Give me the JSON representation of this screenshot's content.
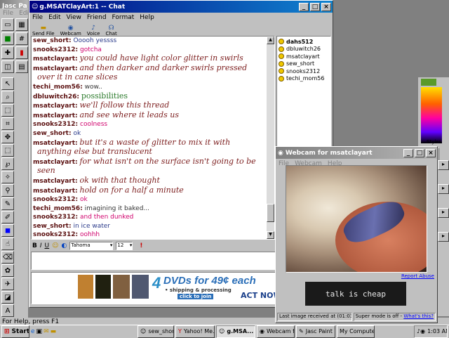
{
  "paint": {
    "title": "Jasc Pa",
    "menu": [
      "File",
      "Edit"
    ],
    "status": "For Help, press F1"
  },
  "chat": {
    "title": "g.MSATClayArt:1 -- Chat",
    "menu": [
      "File",
      "Edit",
      "View",
      "Friend",
      "Format",
      "Help"
    ],
    "toolbar": [
      "Send File",
      "Webcam",
      "Voice",
      "Chat"
    ],
    "messages": [
      {
        "nick": "sew_short:",
        "text": "Ooooh yessss",
        "style": "navy"
      },
      {
        "nick": "snooks2312:",
        "text": "gotcha",
        "style": "pink"
      },
      {
        "nick": "msatclayart:",
        "text": "you could have light color glitter in swirls",
        "style": "script"
      },
      {
        "nick": "msatclayart:",
        "text": "and then darker and darker swirls pressed",
        "style": "script"
      },
      {
        "nick": "",
        "text": "over it in cane slices",
        "style": "script"
      },
      {
        "nick": "techi_mom56:",
        "text": "wow..",
        "style": "gray"
      },
      {
        "nick": "dbluwitch26:",
        "text": "possibilities",
        "style": "green"
      },
      {
        "nick": "msatclayart:",
        "text": "we'll follow this thread",
        "style": "script"
      },
      {
        "nick": "msatclayart:",
        "text": "and see where it leads us",
        "style": "script"
      },
      {
        "nick": "snooks2312:",
        "text": "coolness",
        "style": "pink"
      },
      {
        "nick": "sew_short:",
        "text": "ok",
        "style": "navy"
      },
      {
        "nick": "msatclayart:",
        "text": "but it's a waste of glitter to mix it with",
        "style": "script"
      },
      {
        "nick": "",
        "text": "anything else but translucent",
        "style": "script"
      },
      {
        "nick": "msatclayart:",
        "text": "for what isn't on the surface isn't going to be",
        "style": "script"
      },
      {
        "nick": "",
        "text": "seen",
        "style": "script"
      },
      {
        "nick": "msatclayart:",
        "text": "ok with that thought",
        "style": "script"
      },
      {
        "nick": "msatclayart:",
        "text": "hold on for a half a minute",
        "style": "script"
      },
      {
        "nick": "snooks2312:",
        "text": "ok",
        "style": "pink"
      },
      {
        "nick": "techi_mom56:",
        "text": "imagining it baked...",
        "style": "gray"
      },
      {
        "nick": "snooks2312:",
        "text": "and then dunked",
        "style": "pink"
      },
      {
        "nick": "sew_short:",
        "text": "in ice water",
        "style": "navy"
      },
      {
        "nick": "snooks2312:",
        "text": "oohhh",
        "style": "pink"
      }
    ],
    "users": [
      "dahs512",
      "dbluwitch26",
      "msatclayart",
      "sew_short",
      "snooks2312",
      "techi_mom56"
    ],
    "font": "Tahoma",
    "size": "12",
    "ad": {
      "big": "DVDs for 49¢ each",
      "sub": "• shipping & processing",
      "join": "click to join",
      "cta": "ACT NOW"
    }
  },
  "webcam": {
    "title": "Webcam for msatclayart",
    "menu": [
      "File",
      "Webcam",
      "Help"
    ],
    "report": "Report Abuse",
    "banner": "talk is cheap",
    "last": "Last image received at (01:03:04 AM)",
    "mode": "Super mode is off - ",
    "whats": "What's this?"
  },
  "right": {
    "styles": "Styles"
  },
  "taskbar": {
    "start": "Start",
    "items": [
      "sew_short'...",
      "Yahoo! Me...",
      "g.MSA...",
      "Webcam f...",
      "Jasc Paint ...",
      "My Computer"
    ],
    "time": "1:03 AM"
  }
}
